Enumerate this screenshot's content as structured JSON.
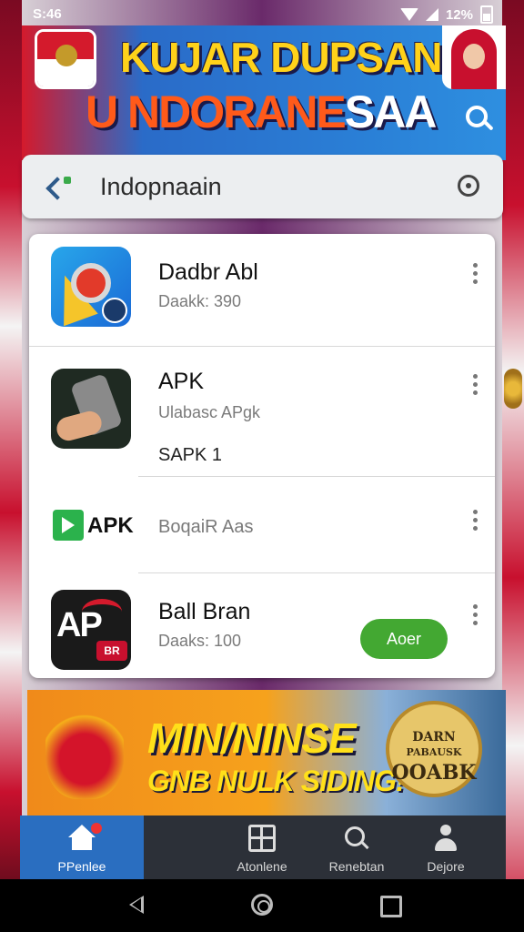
{
  "status_bar": {
    "time": "S:46",
    "battery": "12%"
  },
  "header": {
    "title_line1": "KUJAR DUPSAN",
    "title_line2_a": "U NDORANE",
    "title_line2_b": "SAA"
  },
  "search": {
    "value": "Indopnaain"
  },
  "apps": [
    {
      "name": "Dadbr Abl",
      "subtitle": "Daakk: 390",
      "extra": ""
    },
    {
      "name": "APK",
      "subtitle": "Ulabasc APgk",
      "extra": "SAPK 1"
    },
    {
      "name": "APK",
      "subtitle": "BoqaiR Aas",
      "extra": ""
    },
    {
      "name": "Ball Bran",
      "subtitle": "Daaks: 100",
      "extra": ""
    }
  ],
  "app4_icon_text": "AP",
  "app4_icon_tag": "BR",
  "open_button": "Aoer",
  "banner": {
    "line1": "MIN/NINSE",
    "line2": "GNB NULK SIDING!",
    "seal_top": "DARN",
    "seal_mid": "PABAUSK",
    "seal_bottom": "OOABK"
  },
  "bottom_nav": [
    {
      "label": "PPenlee",
      "active": true
    },
    {
      "label": "Atonlene"
    },
    {
      "label": "Renebtan"
    },
    {
      "label": "Dejore"
    }
  ],
  "colors": {
    "accent_green": "#43a832",
    "nav_active": "#2a6ec0",
    "flag_red": "#d41a2c"
  }
}
